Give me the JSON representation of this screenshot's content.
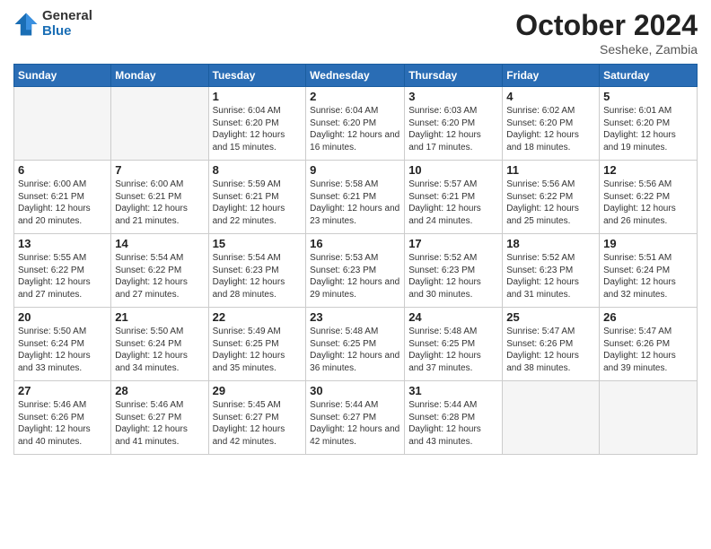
{
  "logo": {
    "general": "General",
    "blue": "Blue"
  },
  "header": {
    "month": "October 2024",
    "location": "Sesheke, Zambia"
  },
  "weekdays": [
    "Sunday",
    "Monday",
    "Tuesday",
    "Wednesday",
    "Thursday",
    "Friday",
    "Saturday"
  ],
  "weeks": [
    [
      {
        "day": "",
        "info": ""
      },
      {
        "day": "",
        "info": ""
      },
      {
        "day": "1",
        "info": "Sunrise: 6:04 AM\nSunset: 6:20 PM\nDaylight: 12 hours and 15 minutes."
      },
      {
        "day": "2",
        "info": "Sunrise: 6:04 AM\nSunset: 6:20 PM\nDaylight: 12 hours and 16 minutes."
      },
      {
        "day": "3",
        "info": "Sunrise: 6:03 AM\nSunset: 6:20 PM\nDaylight: 12 hours and 17 minutes."
      },
      {
        "day": "4",
        "info": "Sunrise: 6:02 AM\nSunset: 6:20 PM\nDaylight: 12 hours and 18 minutes."
      },
      {
        "day": "5",
        "info": "Sunrise: 6:01 AM\nSunset: 6:20 PM\nDaylight: 12 hours and 19 minutes."
      }
    ],
    [
      {
        "day": "6",
        "info": "Sunrise: 6:00 AM\nSunset: 6:21 PM\nDaylight: 12 hours and 20 minutes."
      },
      {
        "day": "7",
        "info": "Sunrise: 6:00 AM\nSunset: 6:21 PM\nDaylight: 12 hours and 21 minutes."
      },
      {
        "day": "8",
        "info": "Sunrise: 5:59 AM\nSunset: 6:21 PM\nDaylight: 12 hours and 22 minutes."
      },
      {
        "day": "9",
        "info": "Sunrise: 5:58 AM\nSunset: 6:21 PM\nDaylight: 12 hours and 23 minutes."
      },
      {
        "day": "10",
        "info": "Sunrise: 5:57 AM\nSunset: 6:21 PM\nDaylight: 12 hours and 24 minutes."
      },
      {
        "day": "11",
        "info": "Sunrise: 5:56 AM\nSunset: 6:22 PM\nDaylight: 12 hours and 25 minutes."
      },
      {
        "day": "12",
        "info": "Sunrise: 5:56 AM\nSunset: 6:22 PM\nDaylight: 12 hours and 26 minutes."
      }
    ],
    [
      {
        "day": "13",
        "info": "Sunrise: 5:55 AM\nSunset: 6:22 PM\nDaylight: 12 hours and 27 minutes."
      },
      {
        "day": "14",
        "info": "Sunrise: 5:54 AM\nSunset: 6:22 PM\nDaylight: 12 hours and 27 minutes."
      },
      {
        "day": "15",
        "info": "Sunrise: 5:54 AM\nSunset: 6:23 PM\nDaylight: 12 hours and 28 minutes."
      },
      {
        "day": "16",
        "info": "Sunrise: 5:53 AM\nSunset: 6:23 PM\nDaylight: 12 hours and 29 minutes."
      },
      {
        "day": "17",
        "info": "Sunrise: 5:52 AM\nSunset: 6:23 PM\nDaylight: 12 hours and 30 minutes."
      },
      {
        "day": "18",
        "info": "Sunrise: 5:52 AM\nSunset: 6:23 PM\nDaylight: 12 hours and 31 minutes."
      },
      {
        "day": "19",
        "info": "Sunrise: 5:51 AM\nSunset: 6:24 PM\nDaylight: 12 hours and 32 minutes."
      }
    ],
    [
      {
        "day": "20",
        "info": "Sunrise: 5:50 AM\nSunset: 6:24 PM\nDaylight: 12 hours and 33 minutes."
      },
      {
        "day": "21",
        "info": "Sunrise: 5:50 AM\nSunset: 6:24 PM\nDaylight: 12 hours and 34 minutes."
      },
      {
        "day": "22",
        "info": "Sunrise: 5:49 AM\nSunset: 6:25 PM\nDaylight: 12 hours and 35 minutes."
      },
      {
        "day": "23",
        "info": "Sunrise: 5:48 AM\nSunset: 6:25 PM\nDaylight: 12 hours and 36 minutes."
      },
      {
        "day": "24",
        "info": "Sunrise: 5:48 AM\nSunset: 6:25 PM\nDaylight: 12 hours and 37 minutes."
      },
      {
        "day": "25",
        "info": "Sunrise: 5:47 AM\nSunset: 6:26 PM\nDaylight: 12 hours and 38 minutes."
      },
      {
        "day": "26",
        "info": "Sunrise: 5:47 AM\nSunset: 6:26 PM\nDaylight: 12 hours and 39 minutes."
      }
    ],
    [
      {
        "day": "27",
        "info": "Sunrise: 5:46 AM\nSunset: 6:26 PM\nDaylight: 12 hours and 40 minutes."
      },
      {
        "day": "28",
        "info": "Sunrise: 5:46 AM\nSunset: 6:27 PM\nDaylight: 12 hours and 41 minutes."
      },
      {
        "day": "29",
        "info": "Sunrise: 5:45 AM\nSunset: 6:27 PM\nDaylight: 12 hours and 42 minutes."
      },
      {
        "day": "30",
        "info": "Sunrise: 5:44 AM\nSunset: 6:27 PM\nDaylight: 12 hours and 42 minutes."
      },
      {
        "day": "31",
        "info": "Sunrise: 5:44 AM\nSunset: 6:28 PM\nDaylight: 12 hours and 43 minutes."
      },
      {
        "day": "",
        "info": ""
      },
      {
        "day": "",
        "info": ""
      }
    ]
  ]
}
